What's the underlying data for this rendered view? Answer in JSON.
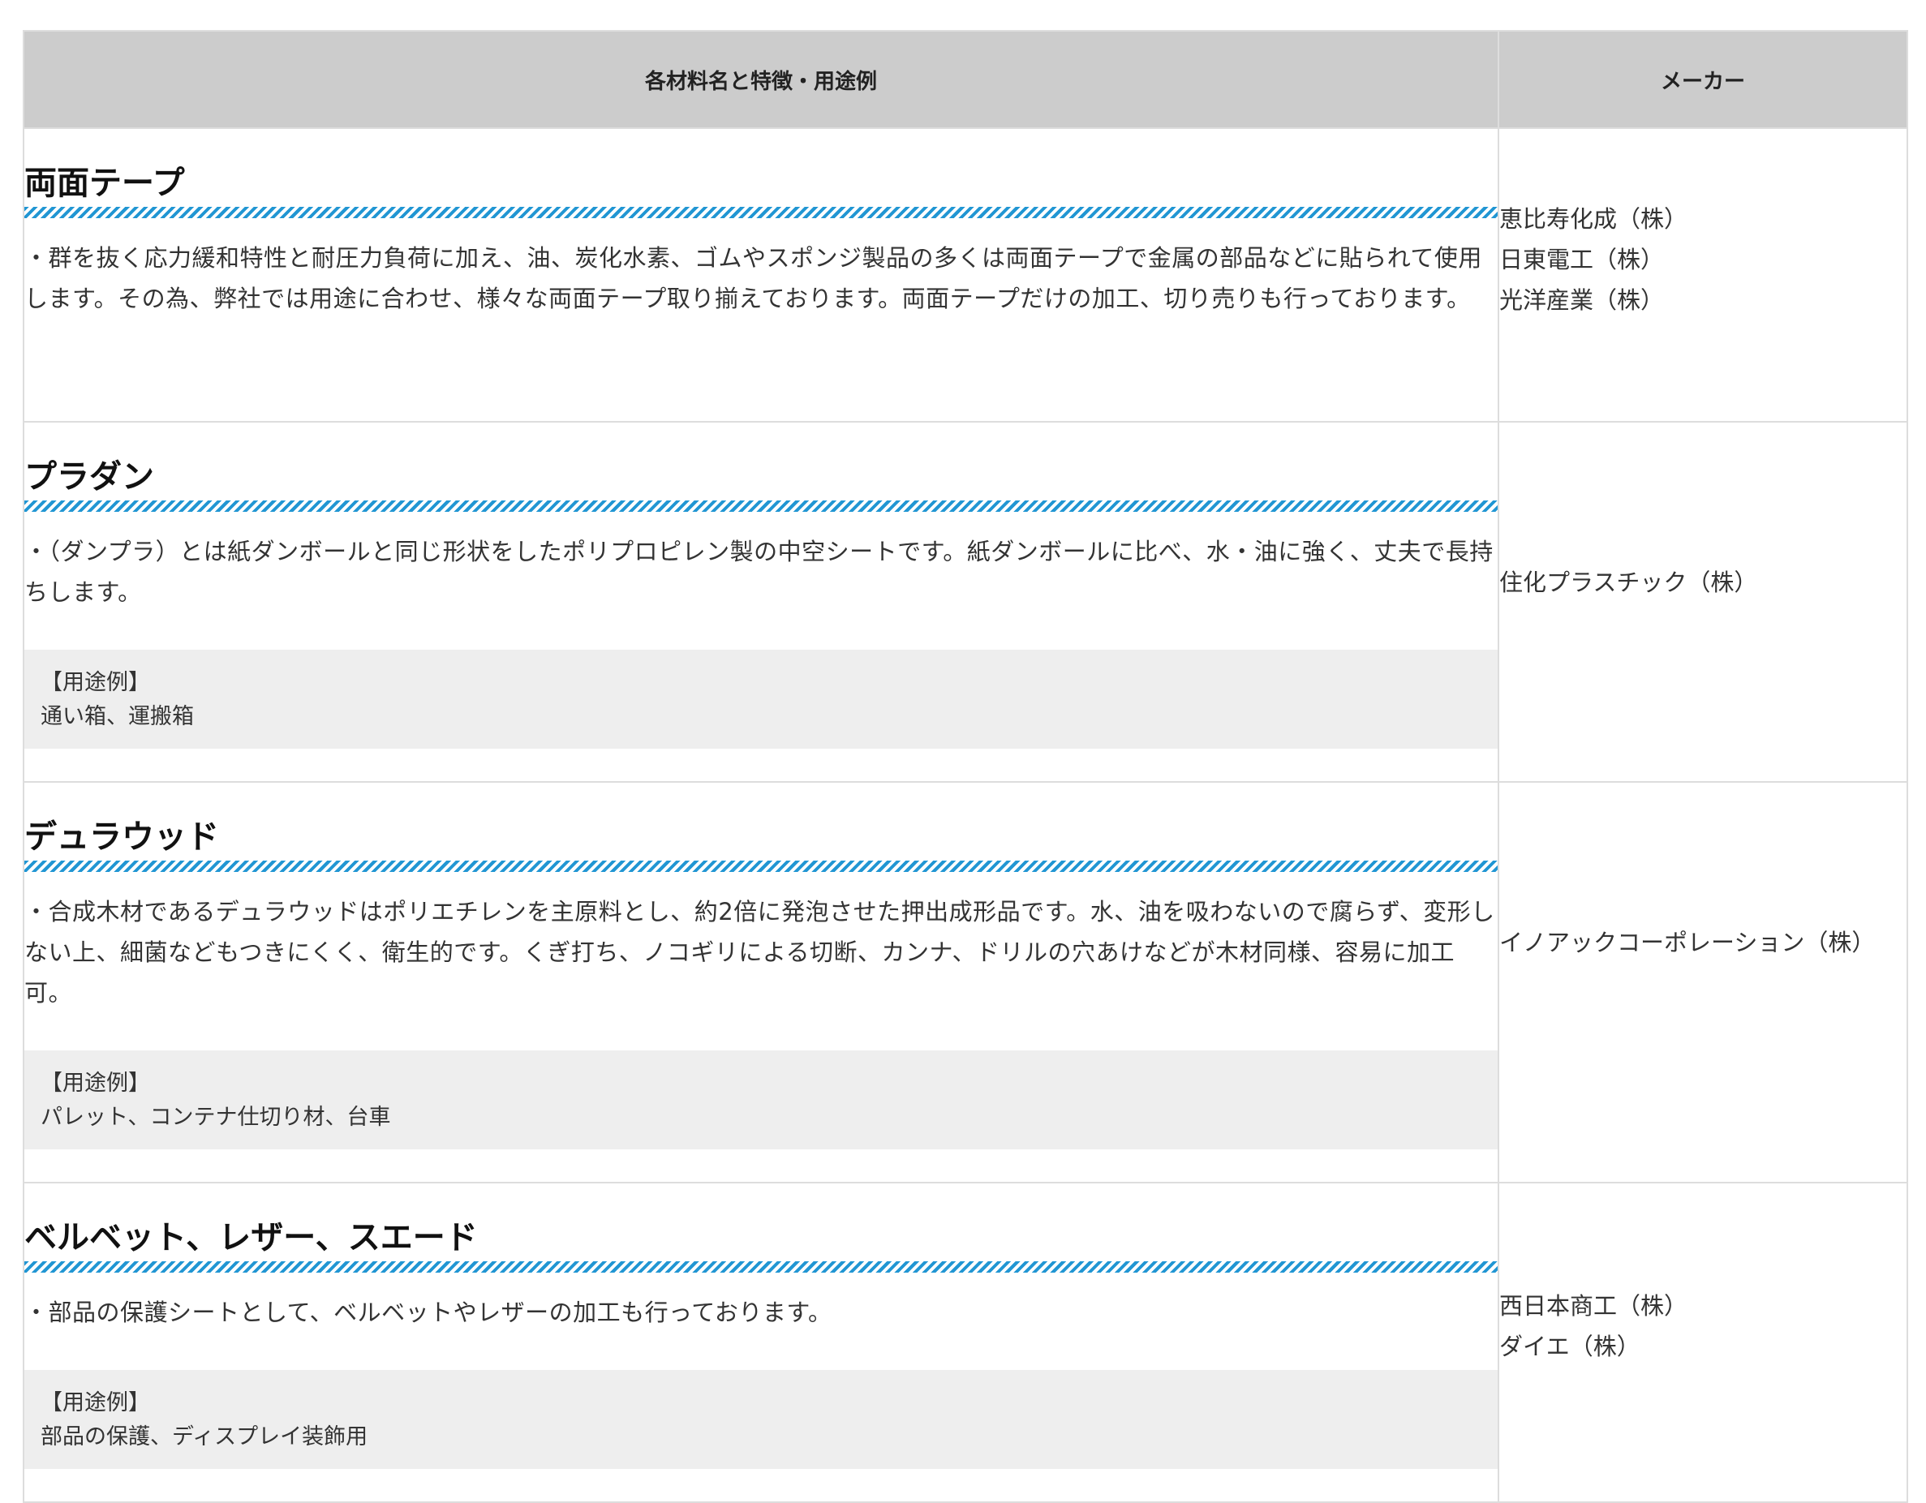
{
  "header": {
    "col1": "各材料名と特徴・用途例",
    "col2": "メーカー"
  },
  "rows": [
    {
      "title": "両面テープ",
      "description": "・群を抜く応力緩和特性と耐圧力負荷に加え、油、炭化水素、ゴムやスポンジ製品の多くは両面テープで金属の部品などに貼られて使用します。その為、弊社では用途に合わせ、様々な両面テープ取り揃えております。両面テープだけの加工、切り売りも行っております。",
      "makers": [
        "恵比寿化成（株）",
        "日東電工（株）",
        "光洋産業（株）"
      ]
    },
    {
      "title": "プラダン",
      "description": "・（ダンプラ）とは紙ダンボールと同じ形状をしたポリプロピレン製の中空シートです。紙ダンボールに比べ、水・油に強く、丈夫で長持ちします。",
      "usage_label": "【用途例】",
      "usage": "通い箱、運搬箱",
      "makers": [
        "住化プラスチック（株）"
      ]
    },
    {
      "title": "デュラウッド",
      "description": "・合成木材であるデュラウッドはポリエチレンを主原料とし、約2倍に発泡させた押出成形品です。水、油を吸わないので腐らず、変形しない上、細菌などもつきにくく、衛生的です。くぎ打ち、ノコギリによる切断、カンナ、ドリルの穴あけなどが木材同様、容易に加工可。",
      "usage_label": "【用途例】",
      "usage": "パレット、コンテナ仕切り材、台車",
      "makers": [
        "イノアックコーポレーション（株）"
      ]
    },
    {
      "title": "ベルベット、レザー、スエード",
      "description": "・部品の保護シートとして、ベルベットやレザーの加工も行っております。",
      "usage_label": "【用途例】",
      "usage": "部品の保護、ディスプレイ装飾用",
      "makers": [
        "西日本商工（株）",
        "ダイエ（株）"
      ]
    }
  ],
  "colors": {
    "header_bg": "#cccccc",
    "stripe": "#2196d3",
    "usage_bg": "#eeeeee",
    "border": "#dddddd"
  }
}
